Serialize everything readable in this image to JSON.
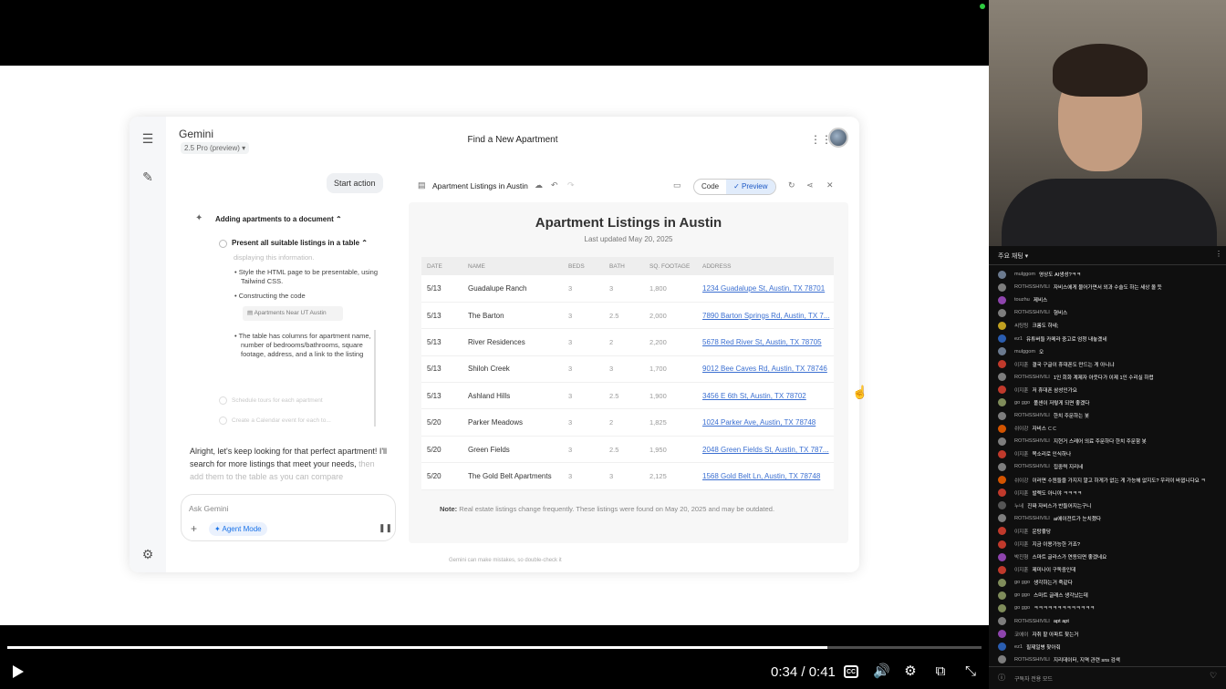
{
  "gemini": {
    "brand": "Gemini",
    "model": "2.5 Pro (preview) ▾",
    "page_title": "Find a New Apartment",
    "start_action": "Start action",
    "task_title": "Adding apartments to a document",
    "subtask_title": "Present all suitable listings in a table",
    "step_faded": "displaying this information.",
    "step1": "• Style the HTML page to be presentable, using Tailwind CSS.",
    "step2": "• Constructing the code",
    "doc_chip": "Apartments Near UT Austin",
    "step3": "• The table has columns for apartment name, number of bedrooms/bathrooms, square footage, address, and a link to the listing",
    "pending1": "Schedule tours for each apartment",
    "pending2": "Create a Calendar event for each to...",
    "reply": "Alright, let's keep looking for that perfect apartment! I'll search for more listings that meet your needs,",
    "reply_faded": "then add them to the table as you can compare",
    "ask_placeholder": "Ask Gemini",
    "agent_mode": "Agent Mode",
    "footnote": "Gemini can make mistakes, so double-check it"
  },
  "canvas": {
    "doc_title": "Apartment Listings in Austin",
    "code_label": "Code",
    "preview_label": "✓ Preview",
    "heading": "Apartment Listings in Austin",
    "updated": "Last updated May 20, 2025",
    "note_label": "Note:",
    "note_text": "Real estate listings change frequently. These listings were found on May 20, 2025 and may be outdated."
  },
  "table": {
    "headers": [
      "DATE",
      "NAME",
      "BEDS",
      "BATH",
      "SQ. FOOTAGE",
      "ADDRESS"
    ],
    "rows": [
      [
        "5/13",
        "Guadalupe Ranch",
        "3",
        "3",
        "1,800",
        "1234 Guadalupe St, Austin, TX 78701"
      ],
      [
        "5/13",
        "The Barton",
        "3",
        "2.5",
        "2,000",
        "7890 Barton Springs Rd, Austin, TX 7..."
      ],
      [
        "5/13",
        "River Residences",
        "3",
        "2",
        "2,200",
        "5678 Red River St, Austin, TX 78705"
      ],
      [
        "5/13",
        "Shiloh Creek",
        "3",
        "3",
        "1,700",
        "9012 Bee Caves Rd, Austin, TX 78746"
      ],
      [
        "5/13",
        "Ashland Hills",
        "3",
        "2.5",
        "1,900",
        "3456 E 6th St, Austin, TX 78702"
      ],
      [
        "5/20",
        "Parker Meadows",
        "3",
        "2",
        "1,825",
        "1024 Parker Ave, Austin, TX 78748"
      ],
      [
        "5/20",
        "Green Fields",
        "3",
        "2.5",
        "1,950",
        "2048 Green Fields St, Austin, TX 787..."
      ],
      [
        "5/20",
        "The Gold Belt Apartments",
        "3",
        "3",
        "2,125",
        "1568 Gold Belt Ln, Austin, TX 78748"
      ]
    ]
  },
  "player": {
    "time": "0:34 / 0:41",
    "progress": 0.842,
    "cc_label": "CC"
  },
  "chat": {
    "header": "주요 채팅 ▾",
    "footer": "구독자 전용 모드",
    "messages": [
      {
        "author": "mulggom",
        "text": "영상도 AI생성?ㅋㅋ",
        "color": "#6b7a8f"
      },
      {
        "author": "ROTHSSHIVILI",
        "text": "자비스에게 물어가면서 외과 수술도 하는 세상 올 듯",
        "color": "#7d7d7d"
      },
      {
        "author": "touzhu",
        "text": "제비스",
        "color": "#8e44ad"
      },
      {
        "author": "ROTHSSHIVILI",
        "text": "형비스",
        "color": "#7d7d7d"
      },
      {
        "author": "씨팅팅",
        "text": "크롬도 하네;",
        "color": "#c0a020"
      },
      {
        "author": "ez1",
        "text": "유튜버들 카메라 중고로 엄청 내놓겠네",
        "color": "#2a5db0"
      },
      {
        "author": "mulggom",
        "text": "오",
        "color": "#6b7a8f"
      },
      {
        "author": "이지훈",
        "text": "결국 구글이 휴대폰도 만드는 게 아니냐",
        "color": "#c0392b"
      },
      {
        "author": "ROTHSSHIVILI",
        "text": "1인 회화 계제자 아웃다가 이제 1인 수리실 하렵",
        "color": "#7d7d7d"
      },
      {
        "author": "이지훈",
        "text": "저 휴대폰 삼성인가요",
        "color": "#c0392b"
      },
      {
        "author": "go ggo",
        "text": "폴센이 저렇게 되면 좋겠다",
        "color": "#7f8c5a"
      },
      {
        "author": "ROTHSSHIVILI",
        "text": "한치 주문하는 봇",
        "color": "#7d7d7d"
      },
      {
        "author": "쉬이강",
        "text": "자비스 ㄷㄷ",
        "color": "#d35400"
      },
      {
        "author": "ROTHSSHIVILI",
        "text": "지현거 스레어 의료 주문하다 한치 주문함 봇",
        "color": "#7d7d7d"
      },
      {
        "author": "이지훈",
        "text": "목소리로 인식하나",
        "color": "#c0392b"
      },
      {
        "author": "ROTHSSHIVILI",
        "text": "집중력 지리네",
        "color": "#7d7d7d"
      },
      {
        "author": "쉬이강",
        "text": "이러면 수원들을 가지지 말고 하게가 없는 게 가능해 없지도? 우리이 바뀝니다요 ㅋ",
        "color": "#d35400"
      },
      {
        "author": "이지훈",
        "text": "발렉도 아니야 ㅋㅋㅋㅋ",
        "color": "#c0392b"
      },
      {
        "author": "누네",
        "text": "진짜 자비스가 반들어지는구니",
        "color": "#555555"
      },
      {
        "author": "ROTHSSHIVILI",
        "text": "ai에이전트가 눈치챘다",
        "color": "#7d7d7d"
      },
      {
        "author": "이지훈",
        "text": "운탕좋당",
        "color": "#c0392b"
      },
      {
        "author": "이지훈",
        "text": "지금 이용가능한 거죠?",
        "color": "#c0392b"
      },
      {
        "author": "박진형",
        "text": "스마트 글라스가 연동되면 좋겠네요",
        "color": "#8e44ad"
      },
      {
        "author": "이지훈",
        "text": "제미나이 구독중인데",
        "color": "#c0392b"
      },
      {
        "author": "go ggo",
        "text": "생각하는거 죽같다",
        "color": "#7f8c5a"
      },
      {
        "author": "go ggo",
        "text": "스마트 글래스 생각났는데",
        "color": "#7f8c5a"
      },
      {
        "author": "go ggo",
        "text": "ㅋㅋㅋㅋㅋㅋㅋㅋㅋㅋㅋㅋㅋ",
        "color": "#7f8c5a"
      },
      {
        "author": "ROTHSSHIVILI",
        "text": "apt apt",
        "color": "#7d7d7d"
      },
      {
        "author": "코에이",
        "text": "자취 할 아파트 찾는거",
        "color": "#8e44ad"
      },
      {
        "author": "ez1",
        "text": "필제일병 찾아줘",
        "color": "#2a5db0"
      },
      {
        "author": "ROTHSSHIVILI",
        "text": "지리데이터, 지역 관련 sns 검색",
        "color": "#7d7d7d"
      }
    ]
  }
}
